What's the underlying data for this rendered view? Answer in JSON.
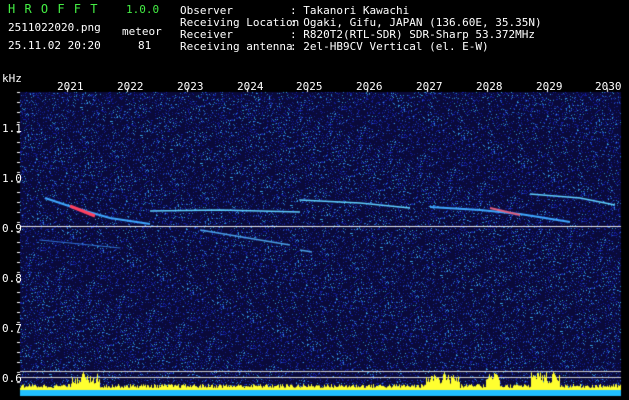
{
  "header": {
    "app_title": "H R O F F T",
    "version": "1.0.0",
    "filename": "2511022020.png",
    "datetime": "25.11.02 20:20",
    "meteor_label": "meteor",
    "meteor_count": "81",
    "info": [
      {
        "label": "Observer",
        "value": ": Takanori Kawachi"
      },
      {
        "label": "Receiving Location",
        "value": ": Ogaki, Gifu, JAPAN (136.60E, 35.35N)"
      },
      {
        "label": "Receiver",
        "value": ": R820T2(RTL-SDR) SDR-Sharp 53.372MHz"
      },
      {
        "label": "Receiving antenna",
        "value": ": 2el-HB9CV Vertical (el. E-W)"
      }
    ]
  },
  "spectrogram": {
    "unit_label": "kHz",
    "x_ticks": [
      "2021",
      "2022",
      "2023",
      "2024",
      "2025",
      "2026",
      "2027",
      "2028",
      "2029",
      "2030"
    ],
    "y_ticks": [
      "1.1",
      "1.0",
      "0.9",
      "0.8",
      "0.7",
      "0.6"
    ],
    "colors": {
      "background": "#0a0a3a",
      "carrier": "#e6e6e6",
      "trace": "#3fa8ff",
      "hot": "#ff4060",
      "bar_top": "#ffff30",
      "bar_base": "#20c0ff"
    }
  }
}
